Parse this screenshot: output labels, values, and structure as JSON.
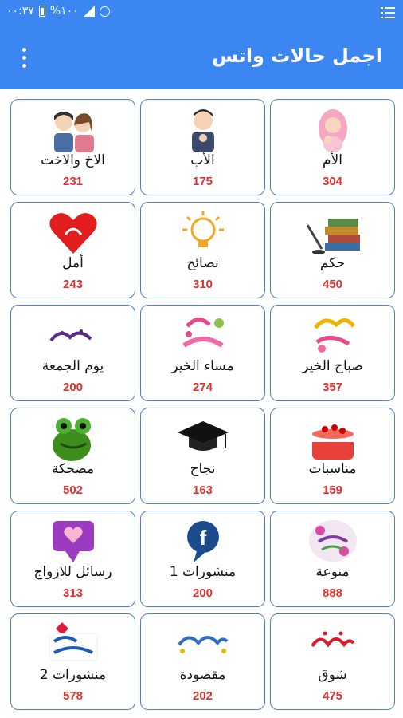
{
  "status_bar": {
    "time": "٠٠:٣٧",
    "battery": "%١٠٠"
  },
  "app_bar": {
    "title": "اجمل حالات واتس",
    "menu_icon": "overflow-menu-icon"
  },
  "colors": {
    "primary": "#3b86f0",
    "count": "#e0302c",
    "card_border": "#4e7fc4"
  },
  "categories": [
    {
      "label": "الأم",
      "count": "304",
      "icon": "mother-icon"
    },
    {
      "label": "الأب",
      "count": "175",
      "icon": "father-icon"
    },
    {
      "label": "الاخ والاخت",
      "count": "231",
      "icon": "siblings-icon"
    },
    {
      "label": "حكم",
      "count": "450",
      "icon": "books-quill-icon"
    },
    {
      "label": "نصائح",
      "count": "310",
      "icon": "lightbulb-icon"
    },
    {
      "label": "أمل",
      "count": "243",
      "icon": "heart-icon"
    },
    {
      "label": "صباح الخير",
      "count": "357",
      "icon": "good-morning-icon"
    },
    {
      "label": "مساء الخير",
      "count": "274",
      "icon": "good-evening-icon"
    },
    {
      "label": "يوم الجمعة",
      "count": "200",
      "icon": "friday-icon"
    },
    {
      "label": "مناسبات",
      "count": "159",
      "icon": "cake-icon"
    },
    {
      "label": "نجاح",
      "count": "163",
      "icon": "graduation-cap-icon"
    },
    {
      "label": "مضحكة",
      "count": "502",
      "icon": "frog-icon"
    },
    {
      "label": "منوعة",
      "count": "888",
      "icon": "various-icon"
    },
    {
      "label": "منشورات 1",
      "count": "200",
      "icon": "facebook-icon"
    },
    {
      "label": "رسائل للازواج",
      "count": "313",
      "icon": "message-heart-icon"
    },
    {
      "label": "شوق",
      "count": "475",
      "icon": "longing-text-icon"
    },
    {
      "label": "مقصودة",
      "count": "202",
      "icon": "intended-text-icon"
    },
    {
      "label": "منشورات 2",
      "count": "578",
      "icon": "posts-icon"
    }
  ]
}
